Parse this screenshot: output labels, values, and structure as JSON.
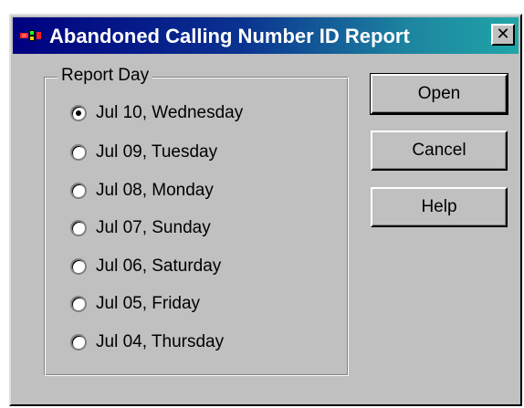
{
  "window": {
    "title": "Abandoned Calling Number ID Report",
    "close_label": "✕",
    "icon": "app-icon"
  },
  "report_day": {
    "label": "Report Day",
    "selected_index": 0,
    "options": [
      "Jul 10, Wednesday",
      "Jul 09, Tuesday",
      "Jul 08, Monday",
      "Jul 07, Sunday",
      "Jul 06, Saturday",
      "Jul 05, Friday",
      "Jul 04, Thursday"
    ]
  },
  "buttons": {
    "open": "Open",
    "cancel": "Cancel",
    "help": "Help"
  },
  "colors": {
    "dialog_bg": "#c0c0c0",
    "title_start": "#000080",
    "title_end": "#1fa6a8",
    "title_text": "#ffffff"
  }
}
